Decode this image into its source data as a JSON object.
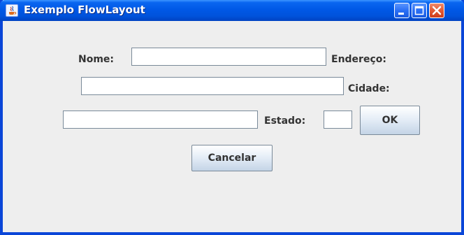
{
  "window": {
    "title": "Exemplo FlowLayout",
    "icon": "java-coffee-icon",
    "controls": [
      "minimize-icon",
      "maximize-icon",
      "close-icon"
    ]
  },
  "form": {
    "nome_label": "Nome:",
    "nome_value": "",
    "endereco_label": "Endereço:",
    "endereco_value": "",
    "cidade_label": "Cidade:",
    "cidade_value": "",
    "estado_label": "Estado:",
    "estado_value": "",
    "ok_label": "OK",
    "cancelar_label": "Cancelar"
  },
  "colors": {
    "titlebar": "#0058e6",
    "window_bg": "#eeeeee",
    "close_button": "#e35a34"
  }
}
